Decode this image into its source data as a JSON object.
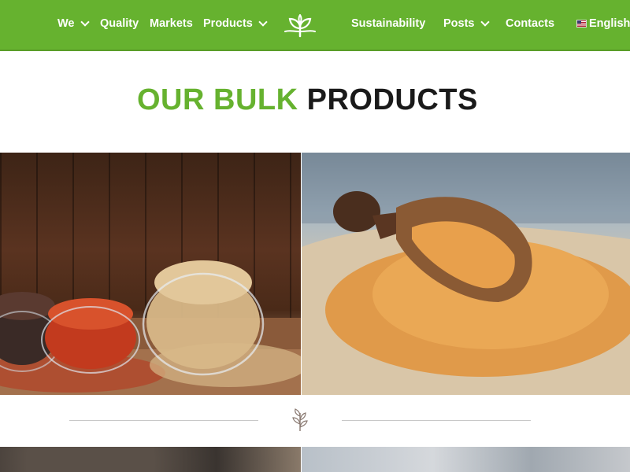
{
  "nav": {
    "items": [
      {
        "label": "We",
        "has_dropdown": true
      },
      {
        "label": "Quality",
        "has_dropdown": false
      },
      {
        "label": "Markets",
        "has_dropdown": false
      },
      {
        "label": "Products",
        "has_dropdown": true
      },
      {
        "label": "Sustainability",
        "has_dropdown": false
      },
      {
        "label": "Posts",
        "has_dropdown": true
      },
      {
        "label": "Contacts",
        "has_dropdown": false
      }
    ],
    "language": {
      "label": "English",
      "flag_icon": "us-flag-icon"
    },
    "logo_icon": "sprout-logo-icon",
    "colors": {
      "bar": "#66b22f",
      "text": "#ffffff"
    }
  },
  "heading": {
    "part1": "OUR BULK",
    "part2": "PRODUCTS",
    "colors": {
      "part1": "#66b22f",
      "part2": "#1a1a1a"
    }
  },
  "products": [
    {
      "image": "quinoa-bowls-photo"
    },
    {
      "image": "quinoa-scoop-photo"
    },
    {
      "image": "chia-seeds-photo"
    },
    {
      "image": "grain-scoop-photo"
    }
  ],
  "divider": {
    "icon": "leaf-sprig-icon"
  }
}
